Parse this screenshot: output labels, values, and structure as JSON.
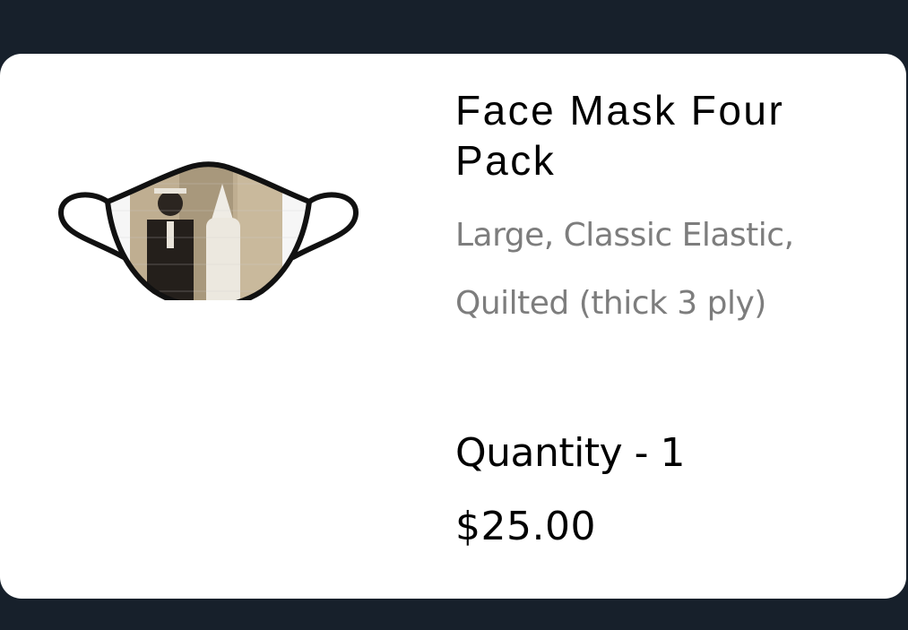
{
  "product": {
    "title": "Face Mask Four Pack",
    "variant": "Large, Classic Elastic, Quilted (thick 3 ply)",
    "quantity_text": "Quantity - 1",
    "price": "$25.00",
    "image_icon": "face-mask-product-image"
  },
  "colors": {
    "page_background": "#17202b",
    "card_background": "#ffffff",
    "title": "#000000",
    "variant": "#7d7d7d"
  }
}
